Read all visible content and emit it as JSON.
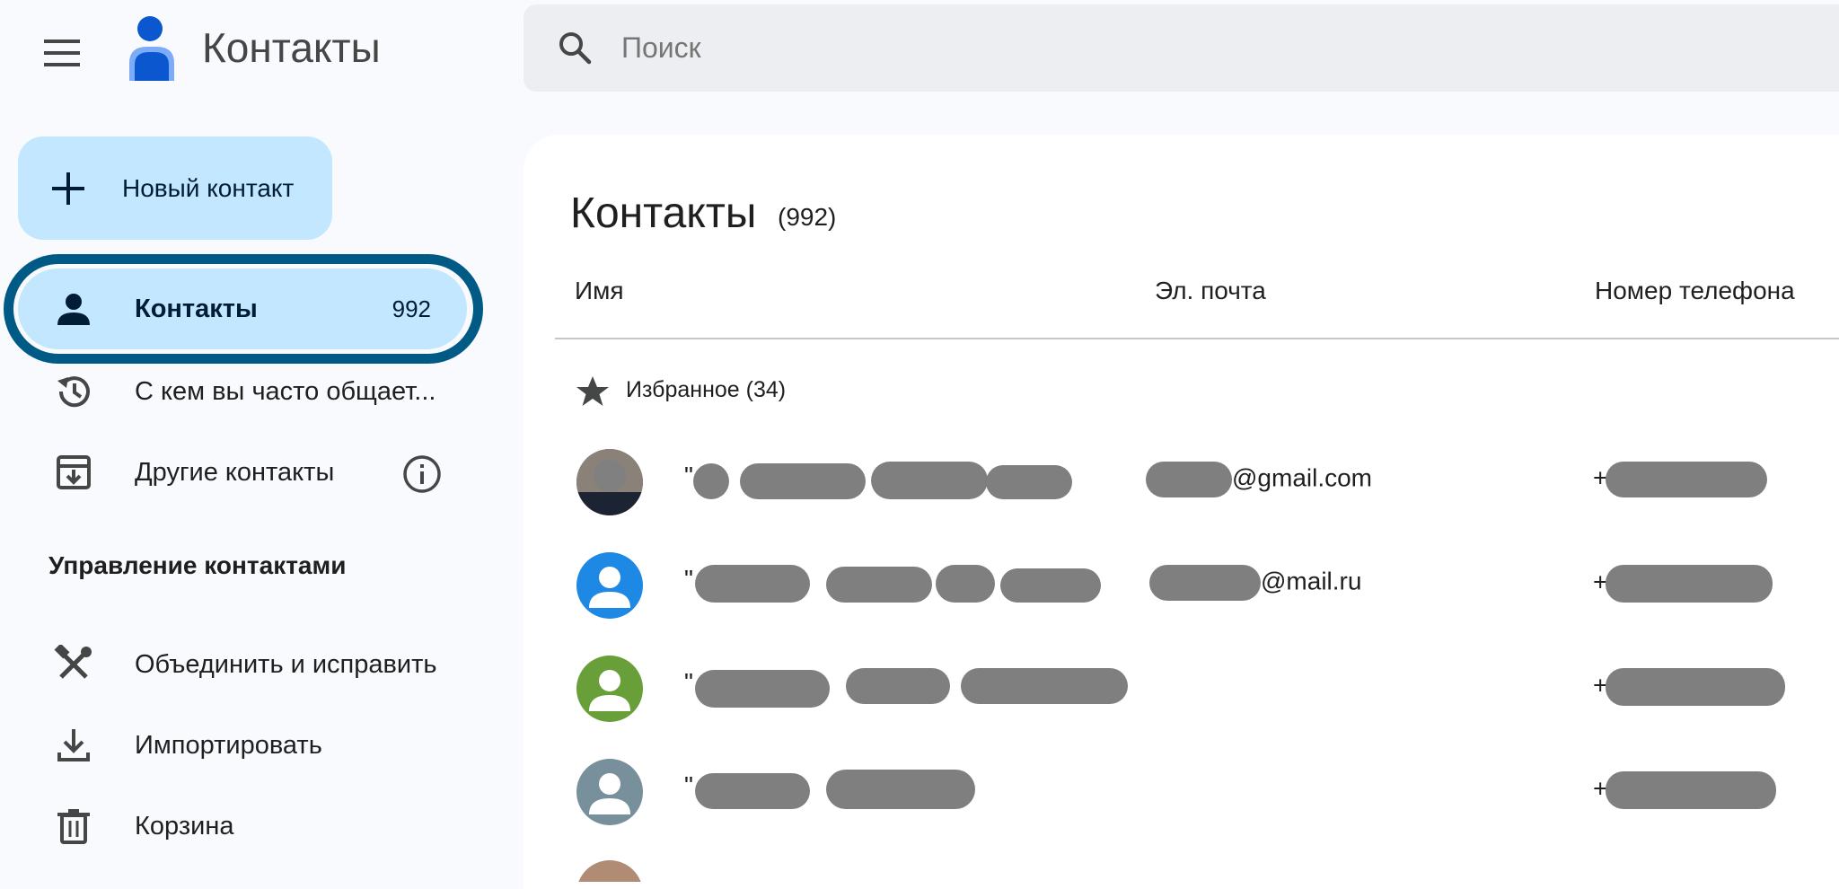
{
  "header": {
    "app_title": "Контакты",
    "search_placeholder": "Поиск"
  },
  "sidebar": {
    "new_contact_label": "Новый контакт",
    "items": [
      {
        "label": "Контакты",
        "count": "992",
        "icon": "person-icon",
        "active": true
      },
      {
        "label": "С кем вы часто общает...",
        "icon": "history-icon"
      },
      {
        "label": "Другие контакты",
        "icon": "archive-download-icon"
      }
    ],
    "manage_title": "Управление контактами",
    "manage_items": [
      {
        "label": "Объединить и исправить",
        "icon": "merge-fix-icon"
      },
      {
        "label": "Импортировать",
        "icon": "import-icon"
      },
      {
        "label": "Корзина",
        "icon": "trash-icon"
      }
    ]
  },
  "main": {
    "title": "Контакты",
    "count": "(992)",
    "columns": {
      "name": "Имя",
      "email": "Эл. почта",
      "phone": "Номер телефона"
    },
    "favorites_label": "Избранное (34)",
    "rows": [
      {
        "name_visible": "\"",
        "email_suffix": "@gmail.com",
        "phone_prefix": "+",
        "avatar": "photo"
      },
      {
        "name_visible": "\"",
        "email_suffix": "@mail.ru",
        "phone_prefix": "+",
        "avatar": "#1e88e5"
      },
      {
        "name_visible": "\"",
        "email_suffix": "",
        "phone_prefix": "+",
        "avatar": "#689f38"
      },
      {
        "name_visible": "\"",
        "email_suffix": "",
        "phone_prefix": "+",
        "avatar": "#78909c"
      }
    ]
  },
  "colors": {
    "accent": "#c2e7ff",
    "highlight_ring": "#005a86",
    "redaction": "#7f7f7f"
  }
}
